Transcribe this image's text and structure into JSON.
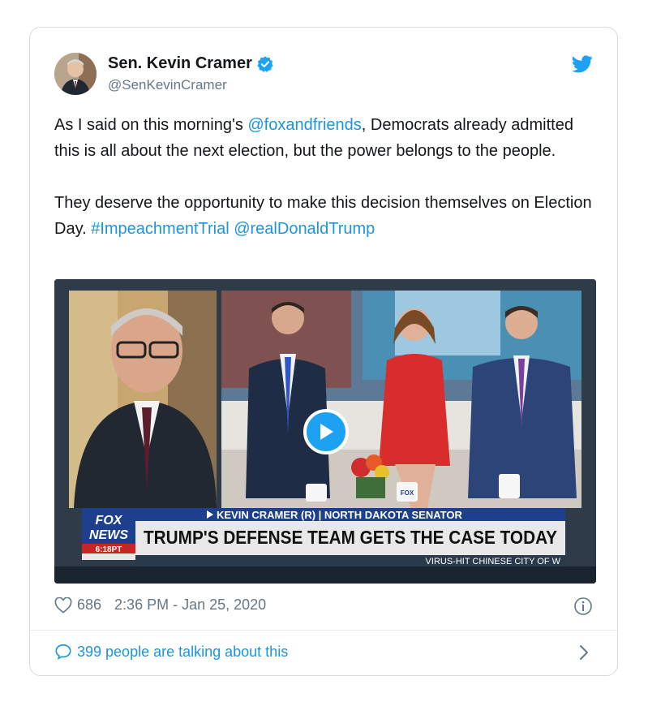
{
  "author": {
    "name": "Sen. Kevin Cramer",
    "handle": "@SenKevinCramer"
  },
  "tweet": {
    "p1_before": "As I said on this morning's ",
    "p1_mention": "@foxandfriends",
    "p1_after": ", Democrats already admitted this is all about the next election, but the power belongs to the people.",
    "p2_before": "They deserve the opportunity to make this decision themselves on Election Day. ",
    "p2_hashtag": "#ImpeachmentTrial",
    "p2_mention": "@realDonaldTrump"
  },
  "video": {
    "logo_line1": "FOX",
    "logo_line2": "NEWS",
    "logo_time": "6:18PT",
    "name_bar": "KEVIN CRAMER (R) | NORTH DAKOTA SENATOR",
    "headline": "TRUMP'S DEFENSE TEAM GETS THE CASE TODAY",
    "ticker": "VIRUS-HIT CHINESE CITY OF W",
    "mug_label": "FOX"
  },
  "meta": {
    "likes": "686",
    "timestamp": "2:36 PM - Jan 25, 2020"
  },
  "conversation": {
    "label": "399 people are talking about this"
  },
  "colors": {
    "accent": "#1b95e0",
    "text": "#14171a",
    "muted": "#657786",
    "fox_blue": "#1d3f8e"
  },
  "icons": [
    "verified-badge-icon",
    "twitter-bird-icon",
    "play-icon",
    "heart-icon",
    "info-icon",
    "speech-bubble-icon",
    "chevron-right-icon"
  ]
}
